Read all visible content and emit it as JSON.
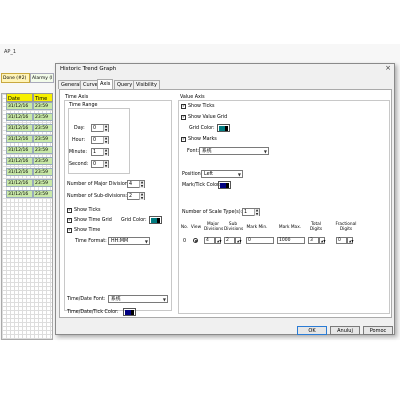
{
  "background": {
    "title": "AP_1",
    "tab_done": "Done (#2)",
    "tab_alarm": "Alarmy (I",
    "col_date": "Date",
    "col_time": "Time",
    "rows": [
      {
        "date": "31/12/16",
        "time": "23:59"
      },
      {
        "date": "31/12/16",
        "time": "23:59"
      },
      {
        "date": "31/12/16",
        "time": "23:59"
      },
      {
        "date": "31/12/16",
        "time": "23:59"
      },
      {
        "date": "31/12/16",
        "time": "23:59"
      },
      {
        "date": "31/12/16",
        "time": "23:59"
      },
      {
        "date": "31/12/16",
        "time": "23:59"
      },
      {
        "date": "31/12/16",
        "time": "23:59"
      },
      {
        "date": "31/12/16",
        "time": "23:59"
      }
    ]
  },
  "dialog": {
    "title": "Historic Trend Graph",
    "close": "×",
    "tabs": [
      "General",
      "Curve",
      "Axis",
      "Query",
      "Visibility"
    ],
    "active_tab": "Axis"
  },
  "time_axis": {
    "label": "Time Axis",
    "range_label": "Time Range",
    "day_label": "Day:",
    "day": "0",
    "hour_label": "Hour:",
    "hour": "0",
    "minute_label": "Minute:",
    "minute": "1",
    "second_label": "Second:",
    "second": "0",
    "major_label": "Number of Major Division:",
    "major": "4",
    "sub_label": "Number of Sub-divisions:",
    "sub": "2",
    "show_ticks": "Show Ticks",
    "show_grid": "Show Time Grid",
    "grid_color_label": "Grid Color:",
    "grid_color": "#007b80",
    "show_time": "Show Time",
    "format_label": "Time Format:",
    "format": "HH:MM",
    "font_label": "Time/Date Font:",
    "font": "系统",
    "tick_color_label": "Time/Date/Tick Color:",
    "tick_color": "#000080"
  },
  "value_axis": {
    "label": "Value Axis",
    "show_ticks": "Show Ticks",
    "show_grid": "Show Value Grid",
    "grid_color_label": "Grid Color:",
    "grid_color": "#007b80",
    "show_marks": "Show Marks",
    "font_label": "Font:",
    "font": "系统",
    "position_label": "Position:",
    "position": "Left",
    "mark_color_label": "Mark/Tick Color:",
    "mark_color": "#000080",
    "scale_types_label": "Number of Scale Type(s):",
    "scale_types": "1",
    "table_headers": {
      "no": "No.",
      "view": "View",
      "major": "Major Divisions",
      "sub": "Sub Divisions",
      "min": "Mark Min.",
      "max": "Mark Max.",
      "total": "Total Digits",
      "fractional": "Fractional Digits"
    },
    "row": {
      "no": "0",
      "major": "4",
      "sub": "2",
      "min": "0",
      "max": "1000",
      "total": "3",
      "fractional": "0"
    }
  },
  "buttons": {
    "ok": "OK",
    "cancel": "Anuluj",
    "help": "Pomoc"
  }
}
